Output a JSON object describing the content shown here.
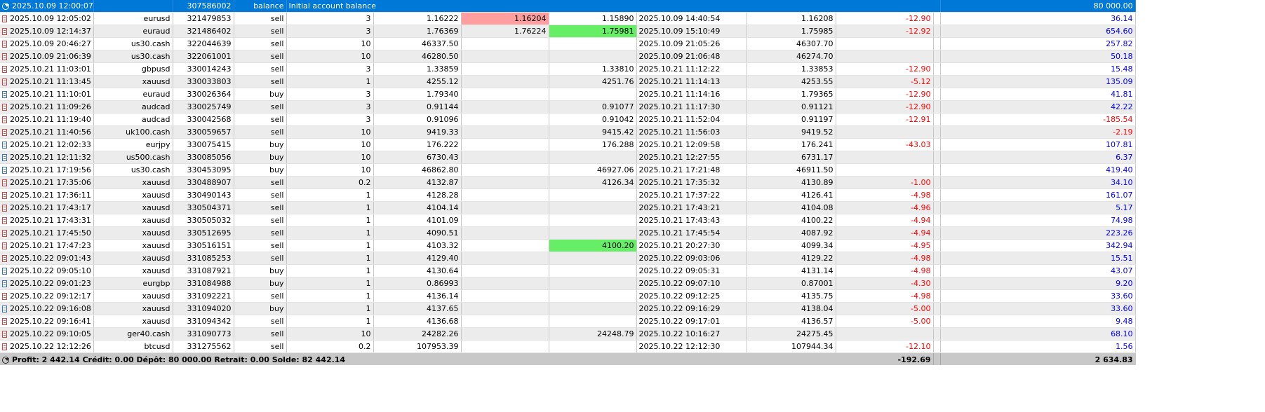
{
  "balance_row": {
    "time": "2025.10.09 12:00:07",
    "ticket": "307586002",
    "type": "balance",
    "comment": "Initial account balance",
    "amount": "80 000.00"
  },
  "rows": [
    {
      "time": "2025.10.09 12:05:02",
      "symbol": "eurusd",
      "ticket": "321479853",
      "type": "sell",
      "volume": "3",
      "price_open": "1.16222",
      "sl": "1.16204",
      "tp": "1.15890",
      "close_time": "2025.10.09 14:40:54",
      "price_close": "1.16208",
      "commission": "-12.90",
      "profit": "36.14",
      "hl_sl": "red",
      "hl_tp": ""
    },
    {
      "time": "2025.10.09 12:14:37",
      "symbol": "euraud",
      "ticket": "321486402",
      "type": "sell",
      "volume": "3",
      "price_open": "1.76369",
      "sl": "1.76224",
      "tp": "1.75981",
      "close_time": "2025.10.09 15:10:49",
      "price_close": "1.75985",
      "commission": "-12.92",
      "profit": "654.60",
      "hl_sl": "",
      "hl_tp": "green"
    },
    {
      "time": "2025.10.09 20:46:27",
      "symbol": "us30.cash",
      "ticket": "322044639",
      "type": "sell",
      "volume": "10",
      "price_open": "46337.50",
      "sl": "",
      "tp": "",
      "close_time": "2025.10.09 21:05:26",
      "price_close": "46307.70",
      "commission": "",
      "profit": "257.82",
      "hl_sl": "",
      "hl_tp": ""
    },
    {
      "time": "2025.10.09 21:06:39",
      "symbol": "us30.cash",
      "ticket": "322061001",
      "type": "sell",
      "volume": "10",
      "price_open": "46280.50",
      "sl": "",
      "tp": "",
      "close_time": "2025.10.09 21:06:48",
      "price_close": "46274.70",
      "commission": "",
      "profit": "50.18",
      "hl_sl": "",
      "hl_tp": ""
    },
    {
      "time": "2025.10.21 11:03:01",
      "symbol": "gbpusd",
      "ticket": "330014243",
      "type": "sell",
      "volume": "3",
      "price_open": "1.33859",
      "sl": "",
      "tp": "1.33810",
      "close_time": "2025.10.21 11:12:22",
      "price_close": "1.33853",
      "commission": "-12.90",
      "profit": "15.48",
      "hl_sl": "",
      "hl_tp": ""
    },
    {
      "time": "2025.10.21 11:13:45",
      "symbol": "xauusd",
      "ticket": "330033803",
      "type": "sell",
      "volume": "1",
      "price_open": "4255.12",
      "sl": "",
      "tp": "4251.76",
      "close_time": "2025.10.21 11:14:13",
      "price_close": "4253.55",
      "commission": "-5.12",
      "profit": "135.09",
      "hl_sl": "",
      "hl_tp": ""
    },
    {
      "time": "2025.10.21 11:10:01",
      "symbol": "euraud",
      "ticket": "330026364",
      "type": "buy",
      "volume": "3",
      "price_open": "1.79340",
      "sl": "",
      "tp": "",
      "close_time": "2025.10.21 11:14:16",
      "price_close": "1.79365",
      "commission": "-12.90",
      "profit": "41.81",
      "hl_sl": "",
      "hl_tp": ""
    },
    {
      "time": "2025.10.21 11:09:26",
      "symbol": "audcad",
      "ticket": "330025749",
      "type": "sell",
      "volume": "3",
      "price_open": "0.91144",
      "sl": "",
      "tp": "0.91077",
      "close_time": "2025.10.21 11:17:30",
      "price_close": "0.91121",
      "commission": "-12.90",
      "profit": "42.22",
      "hl_sl": "",
      "hl_tp": ""
    },
    {
      "time": "2025.10.21 11:19:40",
      "symbol": "audcad",
      "ticket": "330042568",
      "type": "sell",
      "volume": "3",
      "price_open": "0.91096",
      "sl": "",
      "tp": "0.91042",
      "close_time": "2025.10.21 11:52:04",
      "price_close": "0.91197",
      "commission": "-12.91",
      "profit": "-185.54",
      "hl_sl": "",
      "hl_tp": ""
    },
    {
      "time": "2025.10.21 11:40:56",
      "symbol": "uk100.cash",
      "ticket": "330059657",
      "type": "sell",
      "volume": "10",
      "price_open": "9419.33",
      "sl": "",
      "tp": "9415.42",
      "close_time": "2025.10.21 11:56:03",
      "price_close": "9419.52",
      "commission": "",
      "profit": "-2.19",
      "hl_sl": "",
      "hl_tp": ""
    },
    {
      "time": "2025.10.21 12:02:33",
      "symbol": "eurjpy",
      "ticket": "330075415",
      "type": "buy",
      "volume": "10",
      "price_open": "176.222",
      "sl": "",
      "tp": "176.288",
      "close_time": "2025.10.21 12:09:58",
      "price_close": "176.241",
      "commission": "-43.03",
      "profit": "107.81",
      "hl_sl": "",
      "hl_tp": ""
    },
    {
      "time": "2025.10.21 12:11:32",
      "symbol": "us500.cash",
      "ticket": "330085056",
      "type": "buy",
      "volume": "10",
      "price_open": "6730.43",
      "sl": "",
      "tp": "",
      "close_time": "2025.10.21 12:27:55",
      "price_close": "6731.17",
      "commission": "",
      "profit": "6.37",
      "hl_sl": "",
      "hl_tp": ""
    },
    {
      "time": "2025.10.21 17:19:56",
      "symbol": "us30.cash",
      "ticket": "330453095",
      "type": "buy",
      "volume": "10",
      "price_open": "46862.80",
      "sl": "",
      "tp": "46927.06",
      "close_time": "2025.10.21 17:21:48",
      "price_close": "46911.50",
      "commission": "",
      "profit": "419.40",
      "hl_sl": "",
      "hl_tp": ""
    },
    {
      "time": "2025.10.21 17:35:06",
      "symbol": "xauusd",
      "ticket": "330488907",
      "type": "sell",
      "volume": "0.2",
      "price_open": "4132.87",
      "sl": "",
      "tp": "4126.34",
      "close_time": "2025.10.21 17:35:32",
      "price_close": "4130.89",
      "commission": "-1.00",
      "profit": "34.10",
      "hl_sl": "",
      "hl_tp": ""
    },
    {
      "time": "2025.10.21 17:36:11",
      "symbol": "xauusd",
      "ticket": "330490143",
      "type": "sell",
      "volume": "1",
      "price_open": "4128.28",
      "sl": "",
      "tp": "",
      "close_time": "2025.10.21 17:37:22",
      "price_close": "4126.41",
      "commission": "-4.98",
      "profit": "161.07",
      "hl_sl": "",
      "hl_tp": ""
    },
    {
      "time": "2025.10.21 17:43:17",
      "symbol": "xauusd",
      "ticket": "330504371",
      "type": "sell",
      "volume": "1",
      "price_open": "4104.14",
      "sl": "",
      "tp": "",
      "close_time": "2025.10.21 17:43:21",
      "price_close": "4104.08",
      "commission": "-4.96",
      "profit": "5.17",
      "hl_sl": "",
      "hl_tp": ""
    },
    {
      "time": "2025.10.21 17:43:31",
      "symbol": "xauusd",
      "ticket": "330505032",
      "type": "sell",
      "volume": "1",
      "price_open": "4101.09",
      "sl": "",
      "tp": "",
      "close_time": "2025.10.21 17:43:43",
      "price_close": "4100.22",
      "commission": "-4.94",
      "profit": "74.98",
      "hl_sl": "",
      "hl_tp": ""
    },
    {
      "time": "2025.10.21 17:45:50",
      "symbol": "xauusd",
      "ticket": "330512695",
      "type": "sell",
      "volume": "1",
      "price_open": "4090.51",
      "sl": "",
      "tp": "",
      "close_time": "2025.10.21 17:45:54",
      "price_close": "4087.92",
      "commission": "-4.94",
      "profit": "223.26",
      "hl_sl": "",
      "hl_tp": ""
    },
    {
      "time": "2025.10.21 17:47:23",
      "symbol": "xauusd",
      "ticket": "330516151",
      "type": "sell",
      "volume": "1",
      "price_open": "4103.32",
      "sl": "",
      "tp": "4100.20",
      "close_time": "2025.10.21 20:27:30",
      "price_close": "4099.34",
      "commission": "-4.95",
      "profit": "342.94",
      "hl_sl": "",
      "hl_tp": "green"
    },
    {
      "time": "2025.10.22 09:01:43",
      "symbol": "xauusd",
      "ticket": "331085253",
      "type": "sell",
      "volume": "1",
      "price_open": "4129.40",
      "sl": "",
      "tp": "",
      "close_time": "2025.10.22 09:03:06",
      "price_close": "4129.22",
      "commission": "-4.98",
      "profit": "15.51",
      "hl_sl": "",
      "hl_tp": ""
    },
    {
      "time": "2025.10.22 09:05:10",
      "symbol": "xauusd",
      "ticket": "331087921",
      "type": "buy",
      "volume": "1",
      "price_open": "4130.64",
      "sl": "",
      "tp": "",
      "close_time": "2025.10.22 09:05:31",
      "price_close": "4131.14",
      "commission": "-4.98",
      "profit": "43.07",
      "hl_sl": "",
      "hl_tp": ""
    },
    {
      "time": "2025.10.22 09:01:23",
      "symbol": "eurgbp",
      "ticket": "331084988",
      "type": "buy",
      "volume": "1",
      "price_open": "0.86993",
      "sl": "",
      "tp": "",
      "close_time": "2025.10.22 09:07:10",
      "price_close": "0.87001",
      "commission": "-4.30",
      "profit": "9.20",
      "hl_sl": "",
      "hl_tp": ""
    },
    {
      "time": "2025.10.22 09:12:17",
      "symbol": "xauusd",
      "ticket": "331092221",
      "type": "sell",
      "volume": "1",
      "price_open": "4136.14",
      "sl": "",
      "tp": "",
      "close_time": "2025.10.22 09:12:25",
      "price_close": "4135.75",
      "commission": "-4.98",
      "profit": "33.60",
      "hl_sl": "",
      "hl_tp": ""
    },
    {
      "time": "2025.10.22 09:16:08",
      "symbol": "xauusd",
      "ticket": "331094020",
      "type": "buy",
      "volume": "1",
      "price_open": "4137.65",
      "sl": "",
      "tp": "",
      "close_time": "2025.10.22 09:16:29",
      "price_close": "4138.04",
      "commission": "-5.00",
      "profit": "33.60",
      "hl_sl": "",
      "hl_tp": ""
    },
    {
      "time": "2025.10.22 09:16:41",
      "symbol": "xauusd",
      "ticket": "331094342",
      "type": "sell",
      "volume": "1",
      "price_open": "4136.68",
      "sl": "",
      "tp": "",
      "close_time": "2025.10.22 09:17:01",
      "price_close": "4136.57",
      "commission": "-5.00",
      "profit": "9.48",
      "hl_sl": "",
      "hl_tp": ""
    },
    {
      "time": "2025.10.22 09:10:05",
      "symbol": "ger40.cash",
      "ticket": "331090773",
      "type": "sell",
      "volume": "10",
      "price_open": "24282.26",
      "sl": "",
      "tp": "24248.79",
      "close_time": "2025.10.22 10:16:27",
      "price_close": "24275.45",
      "commission": "",
      "profit": "68.10",
      "hl_sl": "",
      "hl_tp": ""
    },
    {
      "time": "2025.10.22 12:12:26",
      "symbol": "btcusd",
      "ticket": "331275562",
      "type": "sell",
      "volume": "0.2",
      "price_open": "107953.39",
      "sl": "",
      "tp": "",
      "close_time": "2025.10.22 12:12:30",
      "price_close": "107944.34",
      "commission": "-12.10",
      "profit": "1.56",
      "hl_sl": "",
      "hl_tp": ""
    }
  ],
  "footer": {
    "summary": "Profit: 2 442.14  Crédit: 0.00  Dépôt: 80 000.00  Retrait: 0.00  Solde: 82 442.14",
    "commission_total": "-192.69",
    "profit_total": "2 634.83"
  },
  "colors": {
    "selection": "#0078d7",
    "negative": "#ff0000",
    "positive": "#0000ff",
    "sl_hit": "#ff9e9e",
    "tp_hit": "#66ee66"
  }
}
